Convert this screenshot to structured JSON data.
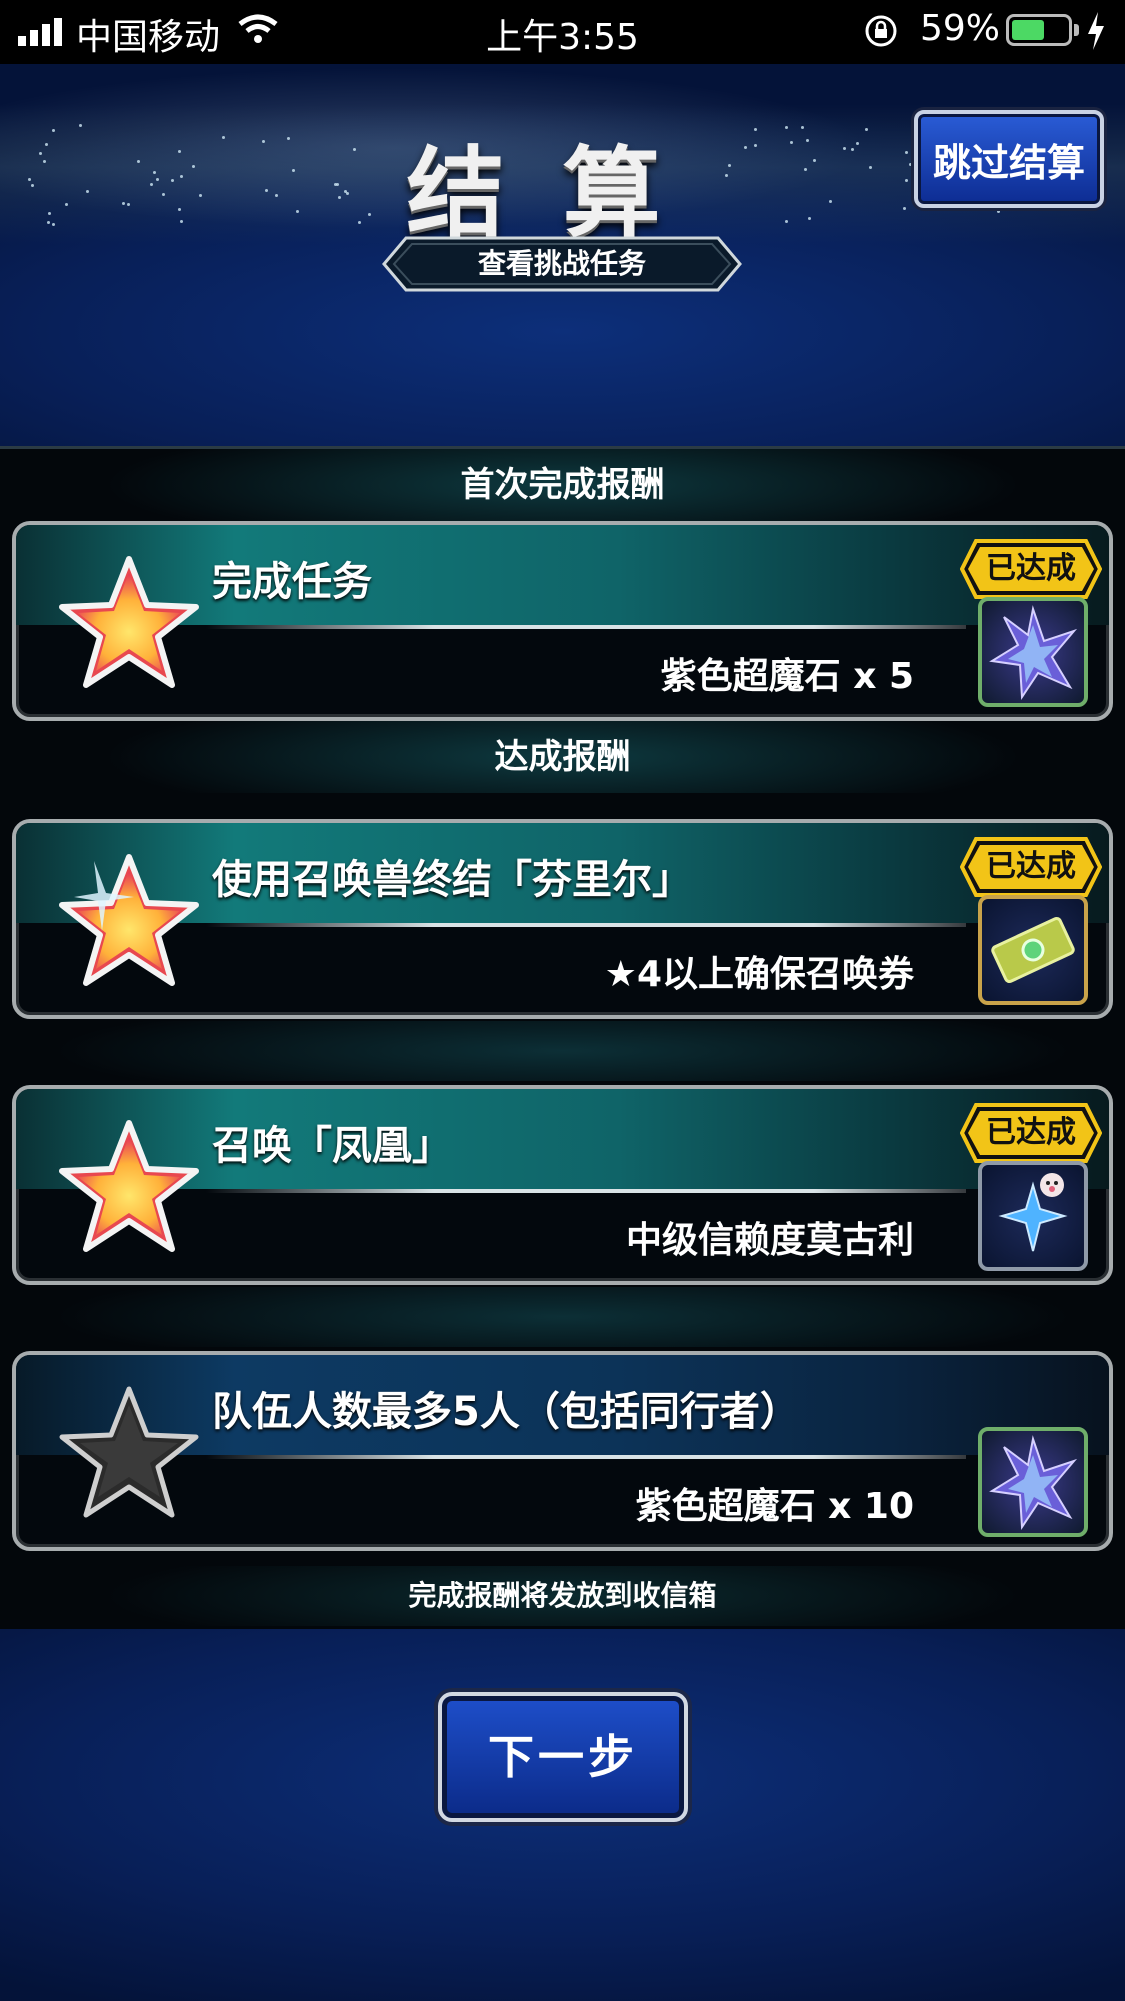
{
  "status_bar": {
    "carrier": "中国移动",
    "time": "上午3:55",
    "battery": "59%",
    "battery_level": 0.59
  },
  "header": {
    "title": "结算",
    "skip_button": "跳过结算",
    "view_missions_button": "查看挑战任务"
  },
  "sections": {
    "first_clear_title": "首次完成报酬",
    "achievement_title": "达成报酬",
    "footer_note": "完成报酬将发放到收信箱"
  },
  "missions": [
    {
      "task": "完成任务",
      "reward": "紫色超魔石 x 5",
      "badge": "已达成",
      "achieved": true,
      "icon": "purple-crystal-icon"
    },
    {
      "task": "使用召唤兽终结「芬里尔」",
      "reward": "★4以上确保召唤券",
      "badge": "已达成",
      "achieved": true,
      "icon": "summon-ticket-icon"
    },
    {
      "task": "召唤「凤凰」",
      "reward": "中级信赖度莫古利",
      "badge": "已达成",
      "achieved": true,
      "icon": "moogle-crystal-icon"
    },
    {
      "task": "队伍人数最多5人（包括同行者）",
      "reward": "紫色超魔石 x 10",
      "badge": "",
      "achieved": false,
      "icon": "purple-crystal-icon"
    }
  ],
  "next_button": "下一步",
  "colors": {
    "accent_blue": "#0d2f7a",
    "teal": "#127a7a",
    "badge_gold": "#f2c417"
  }
}
